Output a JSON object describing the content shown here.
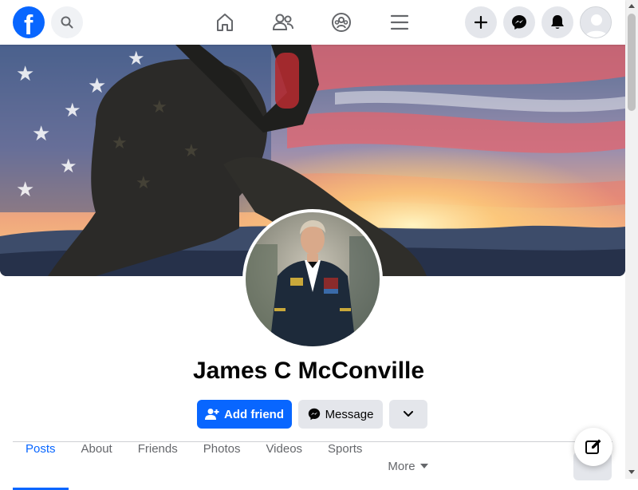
{
  "header": {
    "logo_letter": "f",
    "search_icon": "search-icon",
    "nav_icons": [
      "home-icon",
      "friends-icon",
      "groups-icon",
      "menu-icon"
    ],
    "action_icons": [
      "plus-icon",
      "messenger-icon",
      "bell-icon"
    ]
  },
  "profile": {
    "name": "James C McConville"
  },
  "actions": {
    "add_friend_label": "Add friend",
    "message_label": "Message"
  },
  "tabs": [
    {
      "label": "Posts",
      "active": true
    },
    {
      "label": "About"
    },
    {
      "label": "Friends"
    },
    {
      "label": "Photos"
    },
    {
      "label": "Videos"
    },
    {
      "label": "Sports"
    },
    {
      "label": "More"
    }
  ],
  "colors": {
    "brand": "#0866ff",
    "button_gray": "#e4e6eb",
    "text_primary": "#050505",
    "text_secondary": "#65676b"
  }
}
